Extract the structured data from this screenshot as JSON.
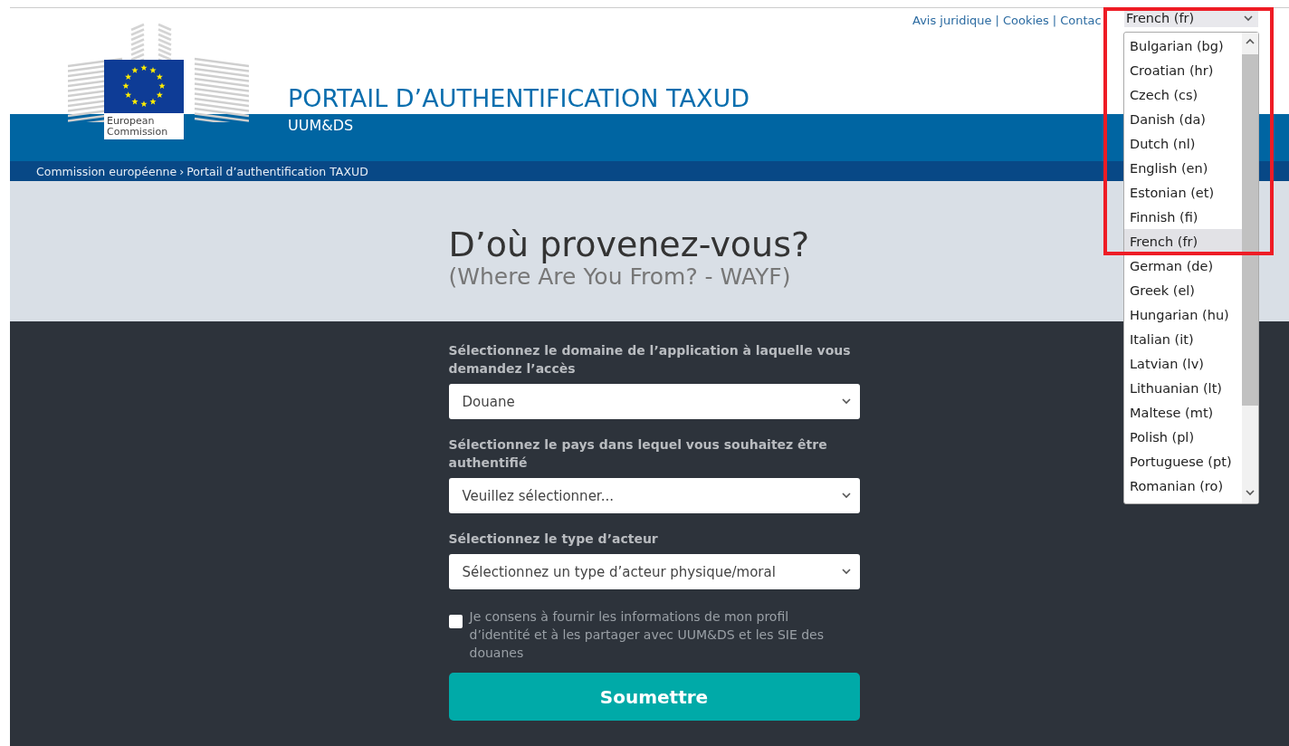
{
  "header": {
    "links": [
      "Avis juridique",
      "Cookies",
      "Contac"
    ],
    "link_separator": "|",
    "logo_caption": [
      "European",
      "Commission"
    ],
    "title": "PORTAIL D’AUTHENTIFICATION TAXUD",
    "subtitle": "UUM&DS"
  },
  "language_select": {
    "value": "French (fr)",
    "expanded": true,
    "options": [
      {
        "label": "Bulgarian (bg)",
        "selected": false
      },
      {
        "label": "Croatian (hr)",
        "selected": false
      },
      {
        "label": "Czech (cs)",
        "selected": false
      },
      {
        "label": "Danish (da)",
        "selected": false
      },
      {
        "label": "Dutch (nl)",
        "selected": false
      },
      {
        "label": "English (en)",
        "selected": false
      },
      {
        "label": "Estonian (et)",
        "selected": false
      },
      {
        "label": "Finnish (fi)",
        "selected": false
      },
      {
        "label": "French (fr)",
        "selected": true
      },
      {
        "label": "German (de)",
        "selected": false
      },
      {
        "label": "Greek (el)",
        "selected": false
      },
      {
        "label": "Hungarian (hu)",
        "selected": false
      },
      {
        "label": "Italian (it)",
        "selected": false
      },
      {
        "label": "Latvian (lv)",
        "selected": false
      },
      {
        "label": "Lithuanian (lt)",
        "selected": false
      },
      {
        "label": "Maltese (mt)",
        "selected": false
      },
      {
        "label": "Polish (pl)",
        "selected": false
      },
      {
        "label": "Portuguese (pt)",
        "selected": false
      },
      {
        "label": "Romanian (ro)",
        "selected": false
      }
    ]
  },
  "breadcrumb": {
    "items": [
      "Commission européenne",
      "Portail d’authentification TAXUD"
    ],
    "separator": "›"
  },
  "hero": {
    "title": "D’où provenez-vous?",
    "subtitle": "(Where Are You From? - WAYF)"
  },
  "form": {
    "fields": [
      {
        "label": "Sélectionnez le domaine de l’application à laquelle vous demandez l’accès",
        "value": "Douane"
      },
      {
        "label": "Sélectionnez le pays dans lequel vous souhaitez être authentifié",
        "value": "Veuillez sélectionner..."
      },
      {
        "label": "Sélectionnez le type d’acteur",
        "value": "Sélectionnez un type d’acteur physique/moral"
      }
    ],
    "consent": {
      "checked": false,
      "text": "Je consens à fournir les informations de mon profil d’identité et à les partager avec UUM&DS et les SIE des douanes"
    },
    "submit": "Soumettre"
  }
}
